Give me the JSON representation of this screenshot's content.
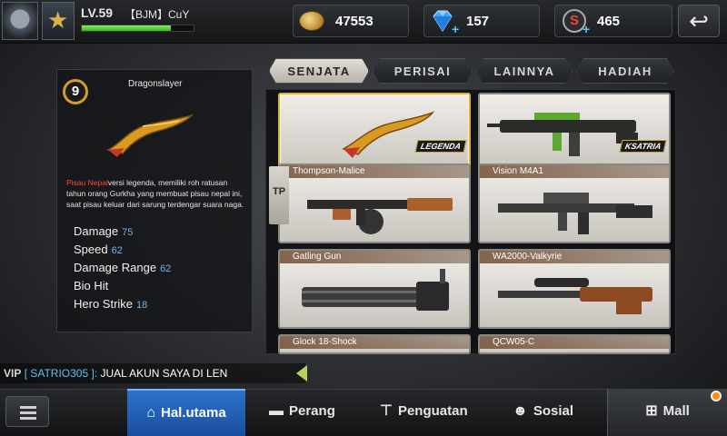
{
  "player": {
    "level": "LV.59",
    "clan_name": "【BJM】CuY",
    "xp_fraction": 0.8
  },
  "currency": {
    "gold": "47553",
    "diamond": "157",
    "s_points": "465",
    "s_icon_letter": "S"
  },
  "selected_weapon": {
    "level": "9",
    "name": "Dragonslayer",
    "desc_highlight": "Pisau Nepal",
    "desc_text": "versi legenda, memiliki roh ratusan tahun orang Gurkha yang membuat pisau nepal ini, saat pisau keluar dari sarung terdengar suara naga.",
    "stats": [
      {
        "label": "Damage",
        "value": "75"
      },
      {
        "label": "Speed",
        "value": "62"
      },
      {
        "label": "Damage Range",
        "value": "62"
      },
      {
        "label": "Bio Hit",
        "value": ""
      },
      {
        "label": "Hero Strike",
        "value": "18"
      }
    ]
  },
  "tabs": [
    "SENJATA",
    "PERISAI",
    "LAINNYA",
    "HADIAH"
  ],
  "active_tab": "SENJATA",
  "side_tab": "TP",
  "weapons": [
    {
      "name": "",
      "tag": "LEGENDA"
    },
    {
      "name": "",
      "tag": "KSATRIA"
    },
    {
      "name": "Thompson-Malice",
      "tag": ""
    },
    {
      "name": "Vision M4A1",
      "tag": ""
    },
    {
      "name": "Gatling Gun",
      "tag": ""
    },
    {
      "name": "WA2000-Valkyrie",
      "tag": ""
    },
    {
      "name": "Glock 18-Shock",
      "tag": ""
    },
    {
      "name": "QCW05-C",
      "tag": ""
    }
  ],
  "chat": {
    "vip": "VIP",
    "user": "[ SATRIO305 ]:",
    "message": "JUAL AKUN SAYA DI LEN"
  },
  "nav": {
    "home": "Hal.utama",
    "battle": "Perang",
    "upgrade": "Penguatan",
    "social": "Sosial",
    "mall": "Mall"
  },
  "icons": {
    "back": "back-arrow-icon",
    "menu": "menu-icon",
    "home": "home-icon",
    "battle": "pistol-icon",
    "upgrade": "hammer-icon",
    "social": "people-icon",
    "mall": "cart-icon"
  },
  "colors": {
    "accent_blue": "#1a4ea0",
    "xp_green": "#3fb324",
    "legend_gold": "#d9b14a",
    "chat_user": "#5ec4f4",
    "desc_red": "#ff4b3b",
    "stat_value": "#6fb7e6"
  }
}
